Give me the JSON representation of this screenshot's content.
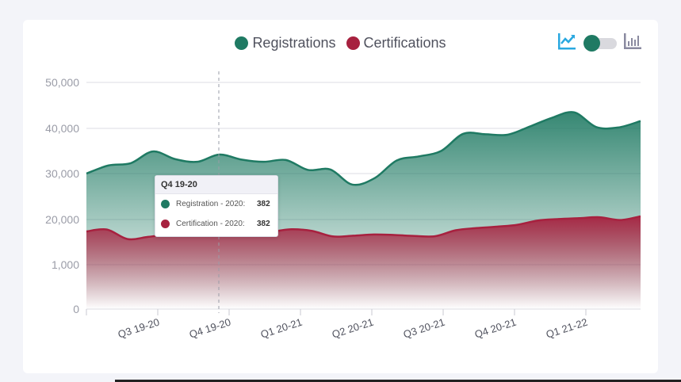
{
  "legend": [
    {
      "label": "Registrations",
      "color": "#1f7a63"
    },
    {
      "label": "Certifications",
      "color": "#a7213f"
    }
  ],
  "toolbar": {
    "line_chart_icon": "line-chart-icon",
    "bar_chart_icon": "bar-chart-icon",
    "accent_color": "#29a8e0",
    "toggle_color": "#1f7a63"
  },
  "tooltip": {
    "title": "Q4 19-20",
    "rows": [
      {
        "label": "Registration - 2020:",
        "value": "382",
        "color": "#1f7a63"
      },
      {
        "label": "Certification - 2020:",
        "value": "382",
        "color": "#a7213f"
      }
    ]
  },
  "chart_data": {
    "type": "area",
    "y_tick_labels": [
      "0",
      "1,000",
      "20,000",
      "30,000",
      "40,000",
      "50,000"
    ],
    "categories": [
      "Q3 19-20",
      "Q4 19-20",
      "Q1 20-21",
      "Q2 20-21",
      "Q3 20-21",
      "Q4 20-21",
      "Q1 21-22"
    ],
    "x": [
      0,
      0.25,
      0.5,
      0.75,
      1,
      1.25,
      1.5,
      1.75,
      2,
      2.25,
      2.5,
      2.75,
      3,
      3.25,
      3.5,
      3.75,
      4,
      4.25,
      4.5,
      4.75,
      5,
      5.25,
      5.5,
      5.75,
      6,
      6.25,
      6.5,
      6.75
    ],
    "series": [
      {
        "name": "Registrations",
        "color": "#1f7a63",
        "values": [
          30000,
          31800,
          32300,
          34900,
          33200,
          32600,
          34200,
          33100,
          32600,
          33000,
          30800,
          30900,
          27600,
          29000,
          32900,
          33800,
          35000,
          38800,
          38700,
          38600,
          40400,
          42300,
          43500,
          40300,
          40200,
          41600
        ]
      },
      {
        "name": "Certifications",
        "color": "#a7213f",
        "values": [
          15000,
          15800,
          11800,
          12700,
          13700,
          14200,
          15100,
          15800,
          15700,
          15000,
          15900,
          15200,
          12900,
          13200,
          13700,
          13500,
          13100,
          13000,
          15500,
          16400,
          17000,
          17800,
          19600,
          20100,
          20300,
          20500,
          19800,
          20700
        ]
      }
    ],
    "hover_index": 1,
    "grid": true,
    "legend_position": "top-center"
  }
}
